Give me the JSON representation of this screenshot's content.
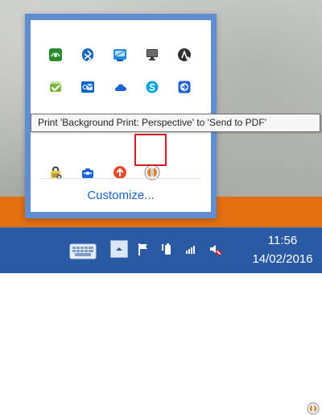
{
  "tooltip": {
    "text": "Print 'Background Print: Perspective' to 'Send to PDF'"
  },
  "flyout": {
    "customize_label": "Customize...",
    "icons": [
      {
        "name": "nvidia-icon"
      },
      {
        "name": "bluetooth-icon"
      },
      {
        "name": "network-manager-icon"
      },
      {
        "name": "display-icon"
      },
      {
        "name": "hp-icon"
      },
      {
        "name": "security-check-icon"
      },
      {
        "name": "outlook-icon"
      },
      {
        "name": "onedrive-icon"
      },
      {
        "name": "skype-icon"
      },
      {
        "name": "teamviewer-icon"
      },
      {
        "name": "app-icon-1"
      },
      {
        "name": "app-icon-2"
      },
      {
        "name": "app-icon-3"
      },
      {
        "name": "app-icon-4"
      },
      {
        "name": "app-icon-5"
      },
      {
        "name": "lock-badge-icon"
      },
      {
        "name": "toolbox-icon"
      },
      {
        "name": "upload-icon"
      },
      {
        "name": "print-status-icon"
      }
    ]
  },
  "taskbar": {
    "time": "11:56",
    "date": "14/02/2016"
  },
  "colors": {
    "taskbar": "#2a5aa3",
    "orange": "#e26f10",
    "highlight": "#d1202a",
    "flyout_border": "#5f8fd0"
  }
}
